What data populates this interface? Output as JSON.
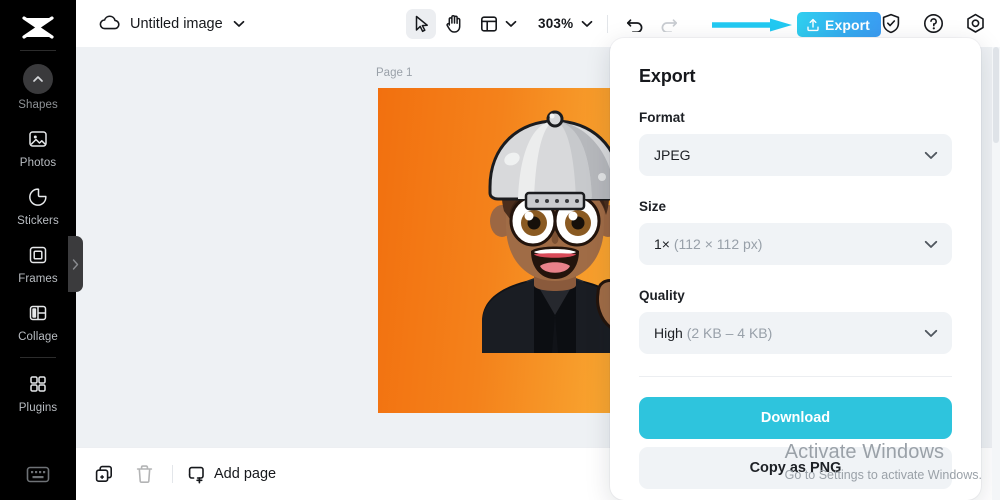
{
  "rail": {
    "logo_icon": "capcut-logo-icon",
    "items": [
      {
        "label": "Shapes",
        "icon": "chevron-up-circle-icon",
        "active": true
      },
      {
        "label": "Photos",
        "icon": "image-icon",
        "active": false
      },
      {
        "label": "Stickers",
        "icon": "sticker-icon",
        "active": false
      },
      {
        "label": "Frames",
        "icon": "frame-icon",
        "active": false
      },
      {
        "label": "Collage",
        "icon": "collage-icon",
        "active": false
      },
      {
        "label": "Plugins",
        "icon": "plugins-grid-icon",
        "active": false
      }
    ],
    "bottom_icon": "keyboard-shortcuts-icon",
    "collapse_icon": "chevron-right-icon"
  },
  "topbar": {
    "cloud_icon": "cloud-saved-icon",
    "doc_title": "Untitled image",
    "doc_title_chevron": "chevron-down-icon",
    "tools": [
      {
        "name": "select-tool",
        "icon": "cursor-arrow-icon"
      },
      {
        "name": "hand-tool",
        "icon": "hand-icon"
      },
      {
        "name": "layout-tool",
        "icon": "layout-panel-icon"
      }
    ],
    "zoom_value": "303%",
    "zoom_chevron": "chevron-down-icon",
    "undo_icon": "undo-arrow-icon",
    "redo_icon": "redo-arrow-icon",
    "export_label": "Export",
    "export_icon": "upload-icon",
    "right_icons": [
      {
        "name": "shield-check-icon"
      },
      {
        "name": "help-question-icon"
      },
      {
        "name": "settings-gear-icon"
      }
    ],
    "annotation_arrow": "cyan-pointer-arrow"
  },
  "workspace": {
    "page_label": "Page 1",
    "canvas_image": "cartoon-boy-thumbs-up-avatar",
    "canvas_background": "orange-gradient"
  },
  "bottombar": {
    "duplicate_icon": "duplicate-page-icon",
    "delete_icon": "trash-icon",
    "add_page_label": "Add page",
    "add_page_icon": "add-page-plus-icon"
  },
  "export_panel": {
    "title": "Export",
    "format": {
      "label": "Format",
      "value": "JPEG",
      "chevron": "chevron-down-icon"
    },
    "size": {
      "label": "Size",
      "value": "1×",
      "detail": "(112 × 112 px)",
      "chevron": "chevron-down-icon"
    },
    "quality": {
      "label": "Quality",
      "value": "High",
      "detail": "(2 KB – 4 KB)",
      "chevron": "chevron-down-icon"
    },
    "download_label": "Download",
    "copy_label": "Copy as PNG"
  },
  "watermark": {
    "title": "Activate Windows",
    "subtitle": "Go to Settings to activate Windows."
  },
  "colors": {
    "rail_bg": "#000000",
    "workspace_bg": "#eef1f4",
    "accent_cyan": "#2ec4dd",
    "export_gradient_start": "#2fd0ef",
    "export_gradient_end": "#3b9cf2",
    "annotation_arrow": "#22c9f2",
    "field_bg": "#f0f3f6",
    "canvas_orange_left": "#f2700f",
    "canvas_orange_right": "#f9b23a"
  }
}
